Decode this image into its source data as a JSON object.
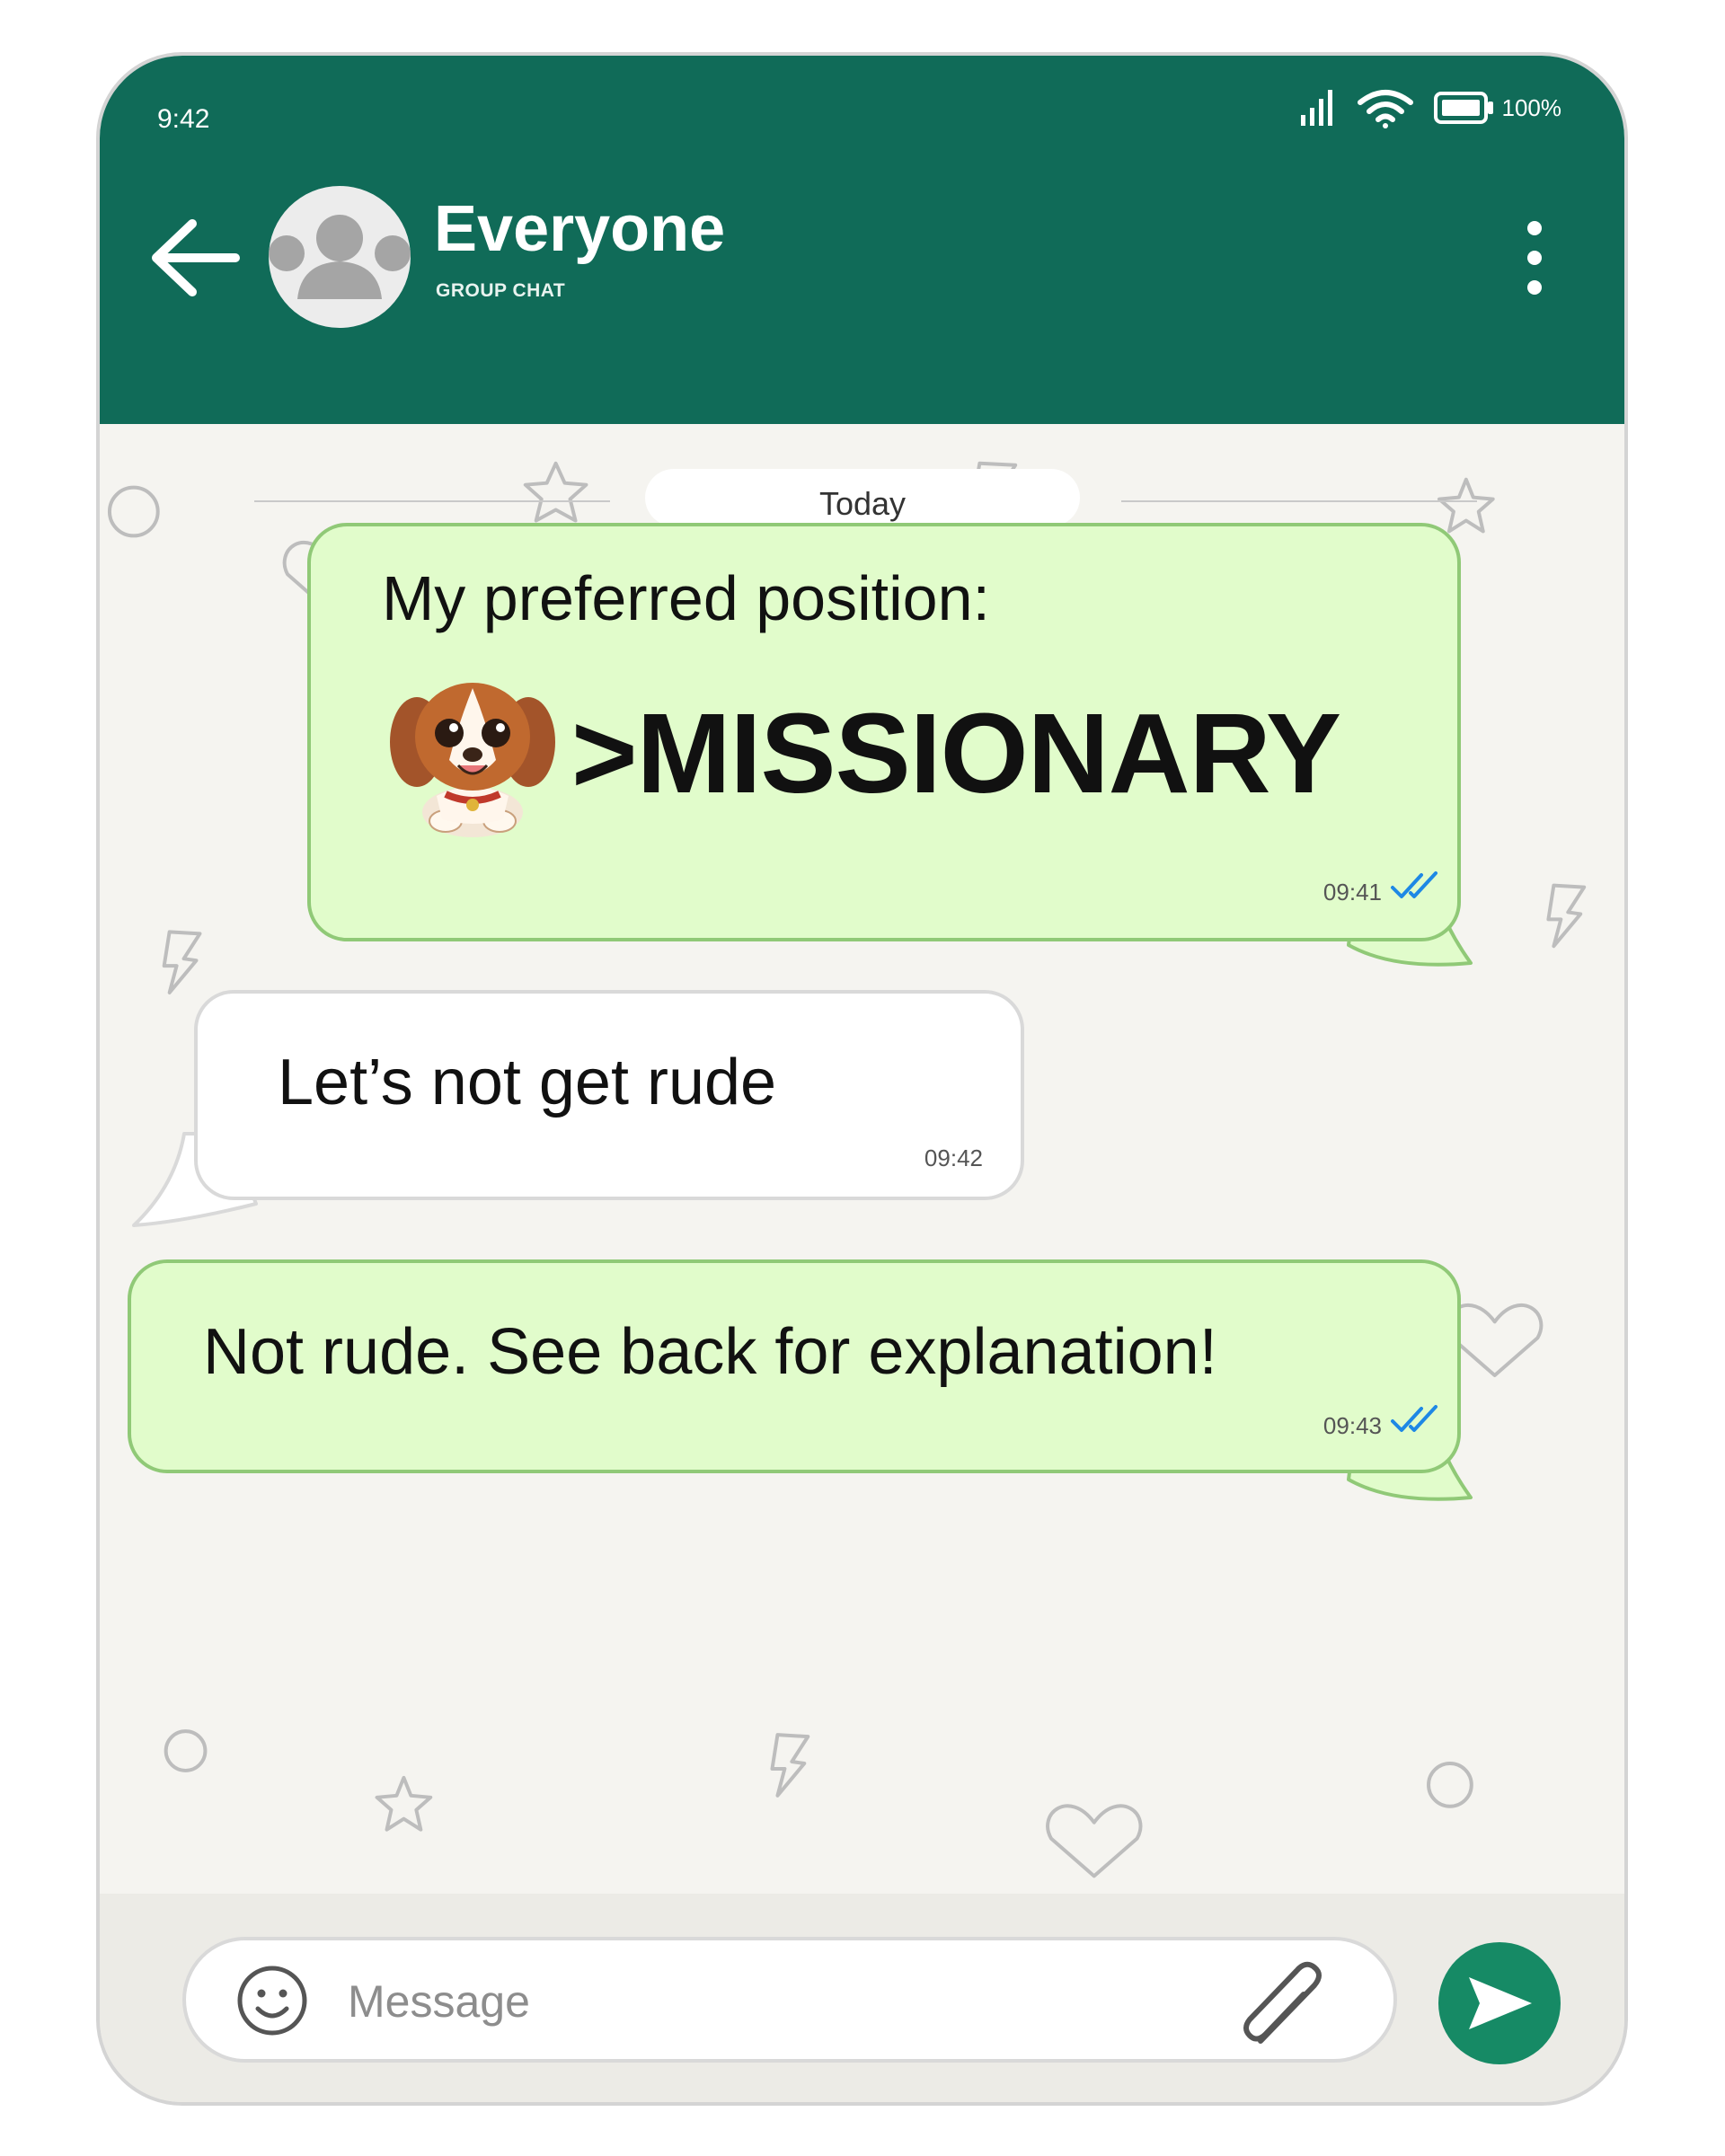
{
  "status_bar": {
    "time": "9:42",
    "battery": "100%"
  },
  "header": {
    "title": "Everyone",
    "subtitle": "GROUP CHAT"
  },
  "date_separator": "Today",
  "messages": [
    {
      "line1": "My preferred position:",
      "line2": ">MISSIONARY",
      "time": "09:41"
    },
    {
      "text": "Let’s not get rude",
      "time": "09:42"
    },
    {
      "text": "Not rude. See back for explanation!",
      "time": "09:43"
    }
  ],
  "composer": {
    "placeholder": "Message"
  },
  "icons": {
    "back": "arrow-left-icon",
    "avatar": "group-avatar-icon",
    "menu": "more-vertical-icon",
    "signal": "signal-icon",
    "wifi": "wifi-icon",
    "battery": "battery-icon",
    "sticker": "puppy-sticker",
    "read": "double-check-icon",
    "emoji": "smiley-icon",
    "attach": "paperclip-icon",
    "send": "send-icon"
  },
  "colors": {
    "header": "#106b58",
    "outgoing": "#e1fccb",
    "incoming": "#ffffff",
    "send": "#168a65",
    "read_ticks": "#1e88e5"
  }
}
